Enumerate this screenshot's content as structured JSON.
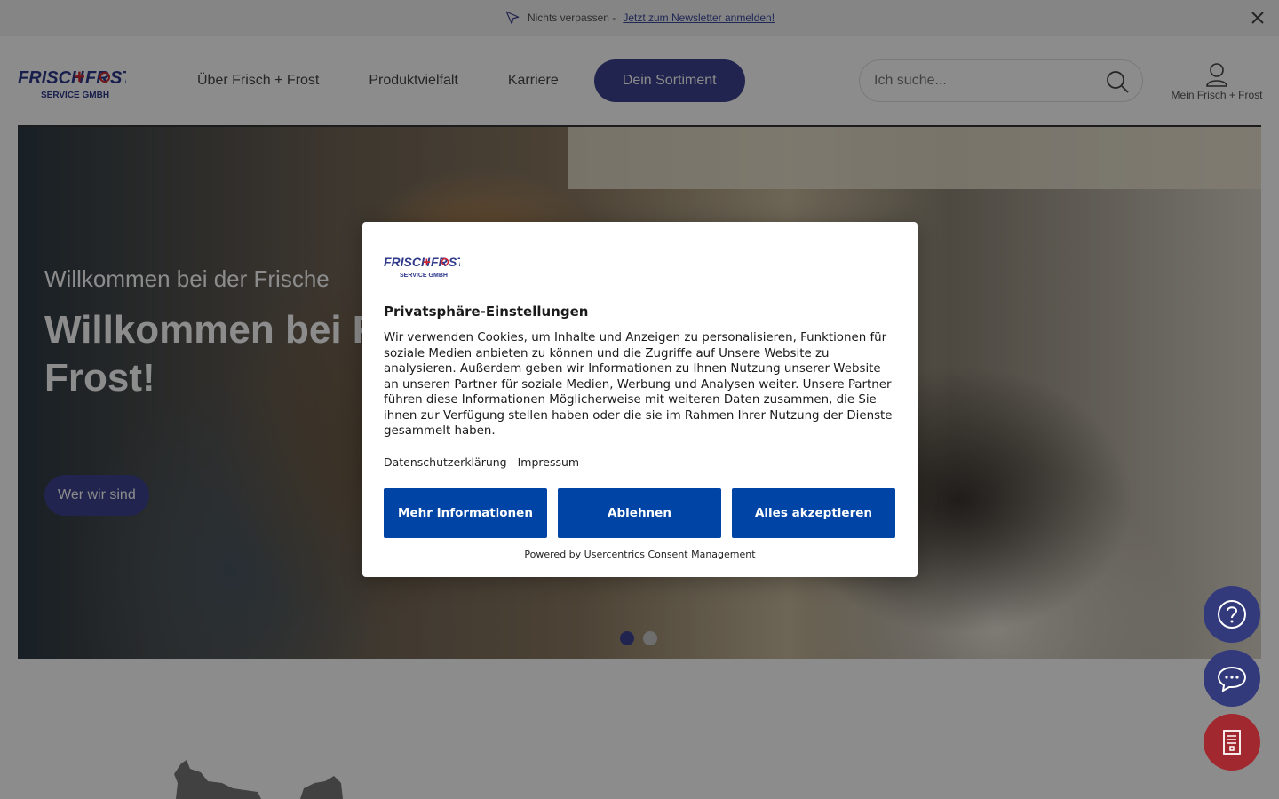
{
  "notice": {
    "text": "Nichts verpassen -",
    "link": "Jetzt zum Newsletter anmelden!"
  },
  "header": {
    "nav": [
      "Über Frisch + Frost",
      "Produktvielfalt",
      "Karriere"
    ],
    "nav_active": "Dein Sortiment",
    "search_placeholder": "Ich suche...",
    "account_label": "Mein Frisch + Frost"
  },
  "logo": {
    "line1a": "Frisch",
    "line1b": "Fr",
    "line1c": "st",
    "line2": "Service GmbH"
  },
  "hero": {
    "subtitle": "Willkommen bei der Frische",
    "title": "Willkommen bei Frisch + Frost!",
    "button": "Wer wir sind",
    "slides": 2,
    "active_slide": 1
  },
  "consent": {
    "title": "Privatsphäre-Einstellungen",
    "text": "Wir verwenden Cookies, um Inhalte und Anzeigen zu personalisieren, Funktionen für soziale Medien anbieten zu können und die Zugriffe auf Unsere Website zu analysieren. Außerdem geben wir Informationen zu Ihnen Nutzung unserer Website an unseren Partner für soziale Medien, Werbung und Analysen weiter. Unsere Partner führen diese Informationen Möglicherweise mit weiteren Daten zusammen, die Sie ihnen zur Verfügung stellen haben oder die sie im Rahmen Ihrer Nutzung der Dienste gesammelt haben.",
    "link_privacy": "Datenschutzerklärung",
    "link_imprint": "Impressum",
    "btn_more": "Mehr Informationen",
    "btn_decline": "Ablehnen",
    "btn_accept": "Alles akzeptieren",
    "powered": "Powered by Usercentrics Consent Management"
  },
  "colors": {
    "brand": "#3d438f",
    "consent_button": "#0045a5",
    "doc_fab": "#a2282f"
  }
}
